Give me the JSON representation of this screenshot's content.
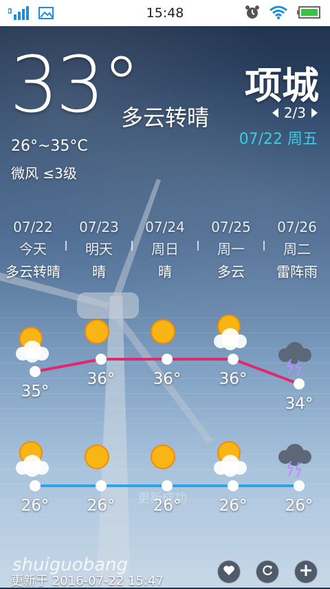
{
  "status_bar": {
    "time": "15:48"
  },
  "current": {
    "temperature": "33°",
    "condition": "多云转晴",
    "range": "26°~35°C",
    "wind": "微风 ≤3级",
    "city": "项城",
    "page": "2/3",
    "date": "07/22 周五"
  },
  "forecast": [
    {
      "date": "07/22",
      "day": "今天",
      "condition": "多云转晴",
      "icon": "partly-cloudy-icon",
      "high": "35°",
      "low": "26°"
    },
    {
      "date": "07/23",
      "day": "明天",
      "condition": "晴",
      "icon": "sunny-icon",
      "high": "36°",
      "low": "26°"
    },
    {
      "date": "07/24",
      "day": "周日",
      "condition": "晴",
      "icon": "sunny-icon",
      "high": "36°",
      "low": "26°"
    },
    {
      "date": "07/25",
      "day": "周一",
      "condition": "多云",
      "icon": "partly-cloudy-icon",
      "high": "36°",
      "low": "26°"
    },
    {
      "date": "07/26",
      "day": "周二",
      "condition": "雷阵雨",
      "icon": "thunderstorm-icon",
      "high": "34°",
      "low": "26°"
    }
  ],
  "chart_data": {
    "type": "line",
    "series": [
      {
        "values": [
          35,
          36,
          36,
          36,
          34
        ],
        "color": "#e0286e"
      },
      {
        "values": [
          26,
          26,
          26,
          26,
          26
        ],
        "color": "#2aa6e8"
      }
    ]
  },
  "watermark": "更新成功",
  "footer": {
    "brand": "shuiguobang",
    "updated": "更新于 2016-07-22 15:47"
  },
  "colors": {
    "accent_date": "#34d0e6",
    "high_line": "#e0286e",
    "low_line": "#2aa6e8"
  }
}
